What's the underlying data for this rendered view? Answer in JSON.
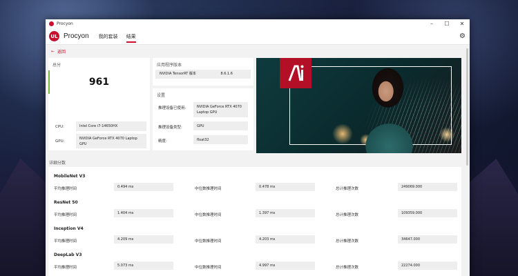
{
  "window": {
    "title": "Procyon"
  },
  "header": {
    "brand": "Procyon",
    "logo_text": "UL",
    "tabs": [
      {
        "label": "我的套装",
        "active": false
      },
      {
        "label": "结果",
        "active": true
      }
    ]
  },
  "back_label": "返回",
  "score_card": {
    "title": "总分",
    "score": "961",
    "cpu_label": "CPU:",
    "cpu_value": "Intel Core i7-14650HX",
    "gpu_label": "GPU:",
    "gpu_value": "NVIDIA GeForce RTX 4070 Laptop GPU"
  },
  "version_card": {
    "title": "应用程序版本",
    "name": "NVIDIA TensorRT 版本",
    "value": "8.6.1.6"
  },
  "settings_card": {
    "title": "设置",
    "rows": [
      {
        "label": "推理设备已使用:",
        "value": "NVIDIA GeForce RTX 4070 Laptop GPU"
      },
      {
        "label": "推理设备类型:",
        "value": "GPU"
      },
      {
        "label": "精度:",
        "value": "float32"
      }
    ]
  },
  "hero": {
    "logo_text": "AI"
  },
  "details": {
    "title": "详细分数",
    "labels": {
      "avg": "平均推理时间",
      "median": "中位数推理时间",
      "total": "总计推理次数"
    },
    "models": [
      {
        "name": "MobileNet V3",
        "avg": "0.494 ms",
        "median": "0.478 ms",
        "total": "249069.000"
      },
      {
        "name": "ResNet 50",
        "avg": "1.404 ms",
        "median": "1.397 ms",
        "total": "109359.000"
      },
      {
        "name": "Inception V4",
        "avg": "4.209 ms",
        "median": "4.203 ms",
        "total": "34647.000"
      },
      {
        "name": "DeepLab V3",
        "avg": "5.073 ms",
        "median": "4.997 ms",
        "total": "22274.000"
      }
    ]
  },
  "colors": {
    "accent": "#c8102e",
    "score_bar": "#7cb342"
  }
}
